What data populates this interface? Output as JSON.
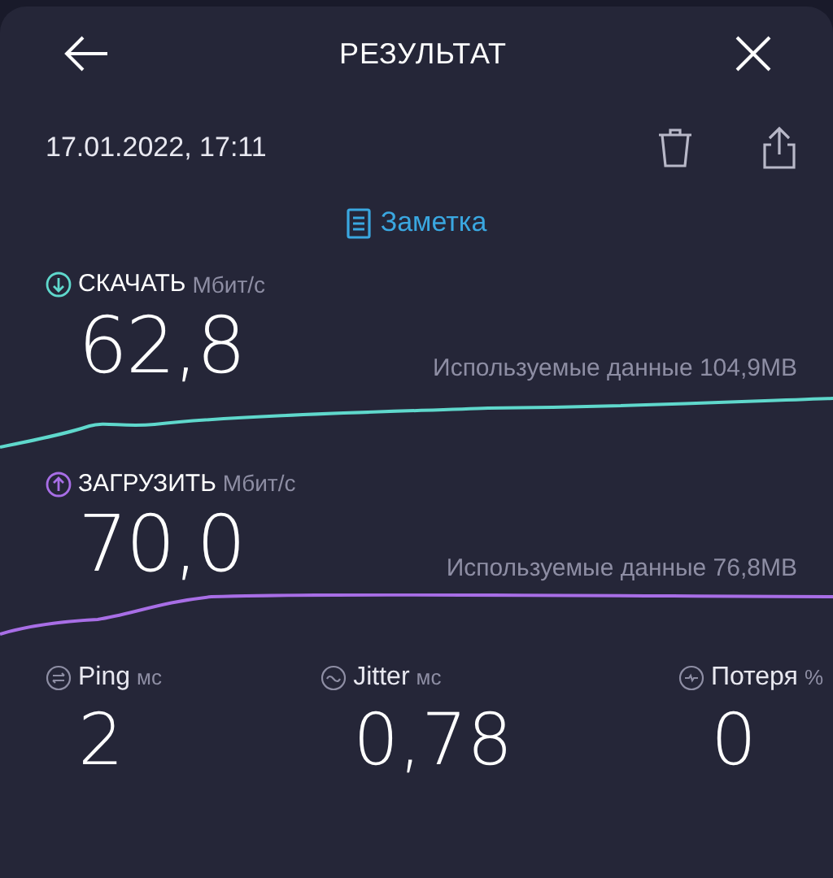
{
  "header": {
    "title": "РЕЗУЛЬТАТ",
    "date": "17.01.2022, 17:11"
  },
  "note": {
    "label": "Заметка"
  },
  "metrics": [
    {
      "kind": "download",
      "label": "СКАЧАТЬ",
      "unit": "Мбит/с",
      "value": "62,8",
      "used_data": "Используемые данные 104,9MB"
    },
    {
      "kind": "upload",
      "label": "ЗАГРУЗИТЬ",
      "unit": "Мбит/с",
      "value": "70,0",
      "used_data": "Используемые данные 76,8MB"
    }
  ],
  "stats": [
    {
      "kind": "ping",
      "label": "Ping",
      "unit": "мс",
      "value": "2"
    },
    {
      "kind": "jitter",
      "label": "Jitter",
      "unit": "мс",
      "value": "0,78"
    },
    {
      "kind": "loss",
      "label": "Потеря",
      "unit": "%",
      "value": "0"
    }
  ]
}
